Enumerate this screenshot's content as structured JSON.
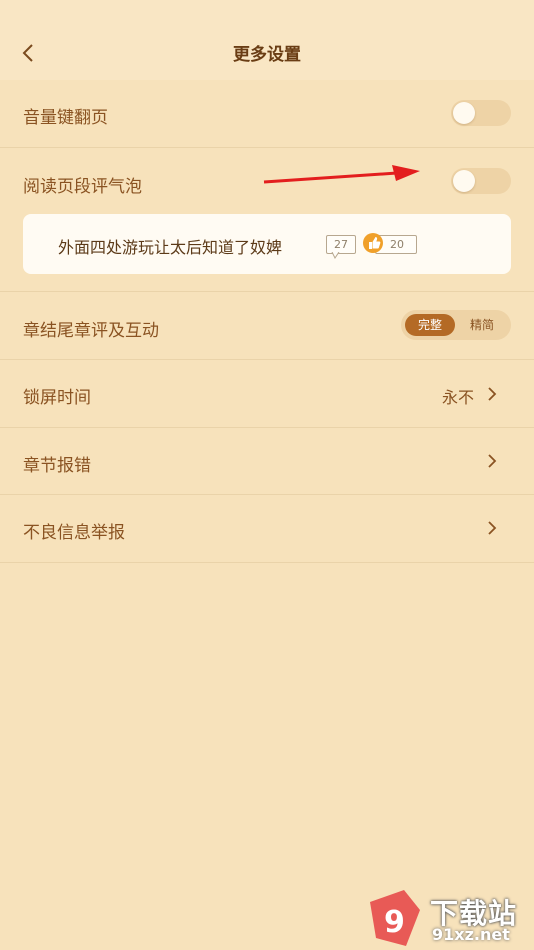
{
  "header": {
    "title": "更多设置"
  },
  "settings": {
    "volume_page_turn": {
      "label": "音量键翻页",
      "enabled": false
    },
    "paragraph_bubble": {
      "label": "阅读页段评气泡",
      "enabled": false
    },
    "preview": {
      "text": "外面四处游玩让太后知道了奴婢",
      "comment_count": "27",
      "like_count": "20"
    },
    "chapter_end": {
      "label": "章结尾章评及互动",
      "options": [
        "完整",
        "精简"
      ],
      "selected": "完整"
    },
    "lock_screen": {
      "label": "锁屏时间",
      "value": "永不"
    },
    "chapter_error": {
      "label": "章节报错"
    },
    "report": {
      "label": "不良信息举报"
    }
  },
  "watermark": {
    "text": "下载站",
    "sub": "91xz.net",
    "logo": "9"
  },
  "colors": {
    "background": "#f7e2bb",
    "accent": "#b46a25",
    "annotation": "#e31e1e"
  }
}
